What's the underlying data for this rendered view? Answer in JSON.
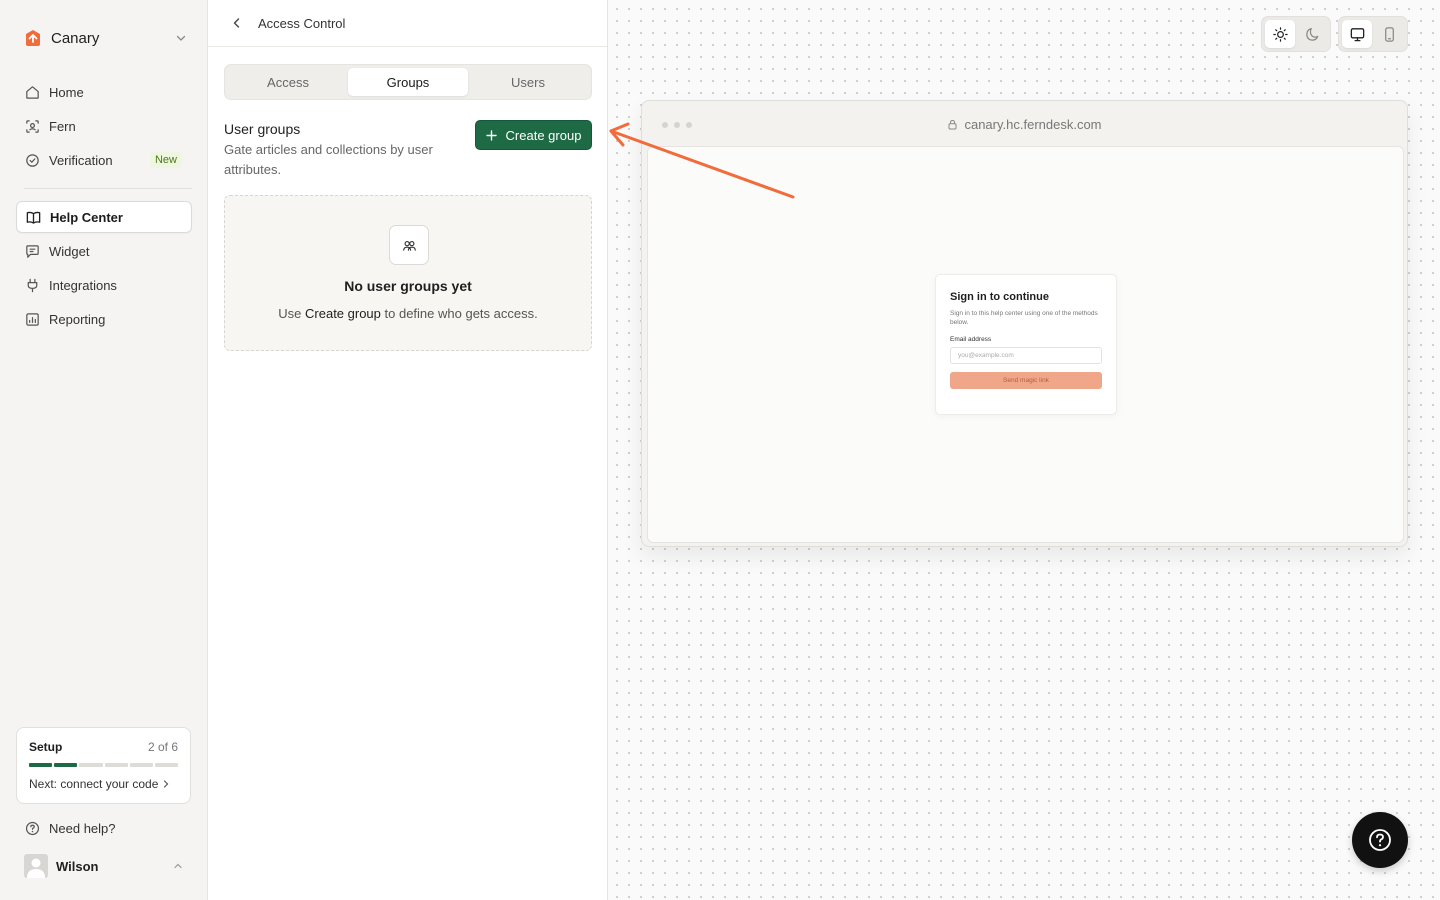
{
  "sidebar": {
    "workspace": "Canary",
    "nav_primary": [
      {
        "label": "Home",
        "icon": "home-icon"
      },
      {
        "label": "Fern",
        "icon": "scan-face-icon"
      },
      {
        "label": "Verification",
        "icon": "check-badge-icon",
        "badge": "New"
      }
    ],
    "nav_secondary": [
      {
        "label": "Help Center",
        "icon": "book-open-icon",
        "active": true
      },
      {
        "label": "Widget",
        "icon": "message-square-icon"
      },
      {
        "label": "Integrations",
        "icon": "plug-icon"
      },
      {
        "label": "Reporting",
        "icon": "chart-icon"
      }
    ],
    "setup": {
      "title": "Setup",
      "count": "2 of 6",
      "progress_done": 2,
      "progress_total": 6,
      "next": "Next: connect your code"
    },
    "help": "Need help?",
    "user": "Wilson"
  },
  "panel": {
    "title": "Access Control",
    "tabs": [
      "Access",
      "Groups",
      "Users"
    ],
    "active_tab": "Groups",
    "section": {
      "title": "User groups",
      "description": "Gate articles and collections by user attributes.",
      "create_button": "Create group"
    },
    "empty": {
      "title": "No user groups yet",
      "text_before": "Use ",
      "text_bold": "Create group",
      "text_after": " to define who gets access."
    }
  },
  "preview": {
    "url": "canary.hc.ferndesk.com",
    "signin": {
      "title": "Sign in to continue",
      "subtitle": "Sign in to this help center using one of the methods below.",
      "email_label": "Email address",
      "email_placeholder": "you@example.com",
      "button": "Send magic link"
    }
  },
  "colors": {
    "brand_orange": "#f26b3a",
    "primary_green": "#1e6a45",
    "annotation_arrow": "#f26b3a",
    "badge_green": "#4a7a1c"
  }
}
